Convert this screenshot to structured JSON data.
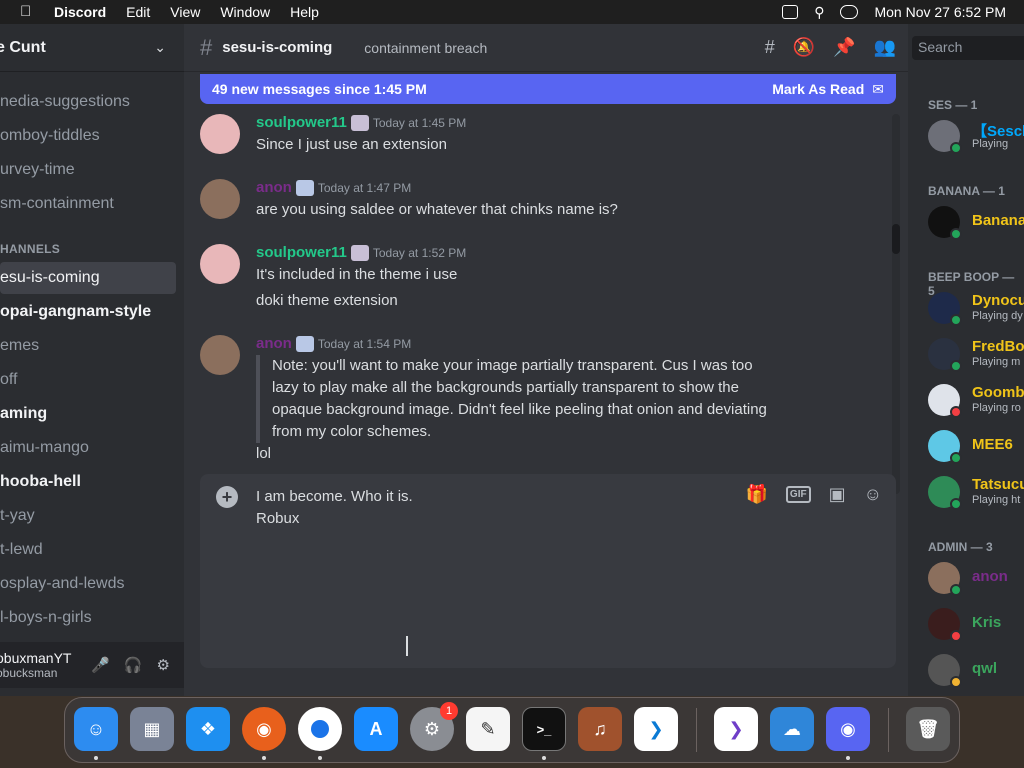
{
  "menubar": {
    "app": "Discord",
    "items": [
      "Edit",
      "View",
      "Window",
      "Help"
    ],
    "clock": "Mon Nov 27  6:52 PM"
  },
  "server": {
    "name": "e Cunt"
  },
  "channels": [
    {
      "name": "nedia-suggestions",
      "state": "normal"
    },
    {
      "name": "omboy-tiddles",
      "state": "normal"
    },
    {
      "name": "urvey-time",
      "state": "normal"
    },
    {
      "name": "sm-containment",
      "state": "normal"
    },
    {
      "name": "esu-is-coming",
      "state": "selected"
    },
    {
      "name": "opai-gangnam-style",
      "state": "unread"
    },
    {
      "name": "emes",
      "state": "normal"
    },
    {
      "name": "off",
      "state": "normal"
    },
    {
      "name": "aming",
      "state": "unread"
    },
    {
      "name": "aimu-mango",
      "state": "normal"
    },
    {
      "name": "hooba-hell",
      "state": "unread"
    },
    {
      "name": "t-yay",
      "state": "normal"
    },
    {
      "name": "t-lewd",
      "state": "normal"
    },
    {
      "name": "osplay-and-lewds",
      "state": "normal"
    },
    {
      "name": "l-boys-n-girls",
      "state": "normal"
    }
  ],
  "category_label": "HANNELS",
  "user": {
    "name": "obuxmanYT",
    "tag": "obucksman"
  },
  "channel_header": {
    "title": "sesu-is-coming",
    "topic": "containment breach"
  },
  "new_messages": {
    "text": "49 new messages since 1:45 PM",
    "action": "Mark As Read"
  },
  "messages": [
    {
      "author": "soulpower11",
      "color": "#23c98a",
      "time": "Today at 1:45 PM",
      "lines": [
        "Since I just use an extension"
      ]
    },
    {
      "author": "anon",
      "color": "#7a2c8a",
      "time": "Today at 1:47 PM",
      "lines": [
        "are you using saldee or whatever that chinks name is?"
      ]
    },
    {
      "author": "soulpower11",
      "color": "#23c98a",
      "time": "Today at 1:52 PM",
      "lines": [
        "It's included in the theme i use",
        "doki theme extension"
      ]
    },
    {
      "author": "anon",
      "color": "#7a2c8a",
      "time": "Today at 1:54 PM",
      "quote": [
        "Note: you'll want to make your image partially transparent. Cus I was too",
        "lazy to play make all the backgrounds partially transparent to show the",
        "opaque background image. Didn't feel like peeling that onion and deviating",
        "from my color schemes."
      ],
      "lines": [
        "lol"
      ]
    }
  ],
  "composer": {
    "lines": [
      "I am become. Who it is.",
      "Robux"
    ],
    "gif_label": "GIF"
  },
  "search": {
    "placeholder": "Search"
  },
  "member_groups": [
    {
      "label": "SES — 1",
      "members": [
        {
          "name": "【Sesch",
          "color": "#00a8fc",
          "activity": "Playing",
          "status": "online"
        }
      ]
    },
    {
      "label": "BANANA — 1",
      "members": [
        {
          "name": "Banana",
          "color": "#f0c419",
          "activity": "",
          "status": "online"
        }
      ]
    },
    {
      "label": "BEEP BOOP — 5",
      "members": [
        {
          "name": "Dynocu",
          "color": "#f0c419",
          "activity": "Playing dy",
          "status": "online"
        },
        {
          "name": "FredBo",
          "color": "#f0c419",
          "activity": "Playing m",
          "status": "online"
        },
        {
          "name": "Goomb",
          "color": "#f0c419",
          "activity": "Playing ro",
          "status": "dnd"
        },
        {
          "name": "MEE6",
          "color": "#f0c419",
          "activity": "",
          "status": "online"
        },
        {
          "name": "Tatsucu",
          "color": "#f0c419",
          "activity": "Playing ht",
          "status": "online"
        }
      ]
    },
    {
      "label": "ADMIN — 3",
      "members": [
        {
          "name": "anon",
          "color": "#7a2c8a",
          "activity": "",
          "status": "online"
        },
        {
          "name": "Kris",
          "color": "#3ba55d",
          "activity": "",
          "status": "dnd"
        },
        {
          "name": "qwl",
          "color": "#3ba55d",
          "activity": "",
          "status": "idle"
        }
      ]
    }
  ],
  "dock": {
    "apps": [
      "finder-icon",
      "launchpad-icon",
      "safari-icon",
      "firefox-icon",
      "chrome-icon",
      "appstore-icon",
      "settings-icon",
      "textedit-icon",
      "terminal-icon",
      "garageband-icon",
      "vscode-icon",
      "visualstudio-icon",
      "weather-icon",
      "discord-icon",
      "trash-icon"
    ],
    "settings_badge": "1"
  }
}
